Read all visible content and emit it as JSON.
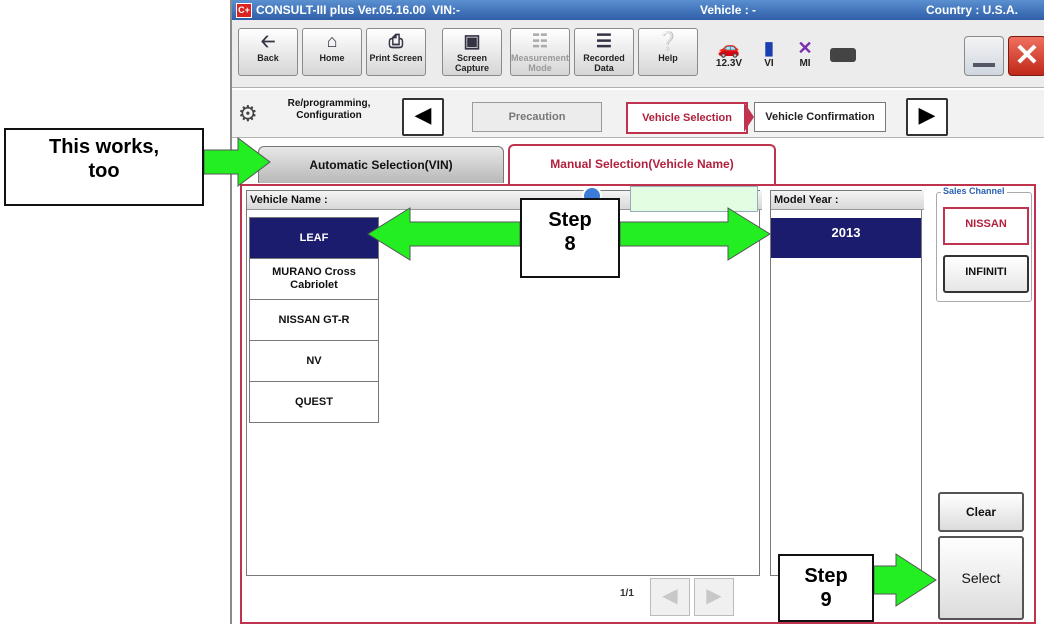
{
  "window": {
    "title": "CONSULT-III plus  Ver.05.16.00",
    "vin_label": "VIN:-",
    "vehicle_label": "Vehicle : -",
    "country_label": "Country : U.S.A."
  },
  "toolbar": {
    "buttons": [
      {
        "label": "Back",
        "icon": "back-arrow-icon"
      },
      {
        "label": "Home",
        "icon": "home-icon"
      },
      {
        "label": "Print Screen",
        "icon": "printer-icon"
      },
      {
        "label": "Screen Capture",
        "icon": "camera-icon"
      },
      {
        "label": "Measurement Mode",
        "icon": "measurement-icon"
      },
      {
        "label": "Recorded Data",
        "icon": "recorded-data-icon"
      },
      {
        "label": "Help",
        "icon": "help-icon"
      }
    ],
    "status": {
      "battery": "12.3V",
      "vi": "VI",
      "mi": "MI"
    }
  },
  "navigation": {
    "section_label": "Re/programming, Configuration",
    "steps": [
      "Precaution",
      "Vehicle Selection",
      "Vehicle Confirmation"
    ]
  },
  "tabs": {
    "automatic": "Automatic Selection(VIN)",
    "manual": "Manual Selection(Vehicle Name)"
  },
  "vehicle_list": {
    "header": "Vehicle Name :",
    "items": [
      "LEAF",
      "MURANO Cross Cabriolet",
      "NISSAN GT-R",
      "NV",
      "QUEST"
    ],
    "selected_index": 0,
    "page": "1/1"
  },
  "model_year": {
    "header": "Model Year :",
    "items": [
      "2013"
    ]
  },
  "sales_channel": {
    "label": "Sales Channel",
    "options": [
      "NISSAN",
      "INFINITI"
    ]
  },
  "actions": {
    "clear": "Clear",
    "select": "Select"
  },
  "callouts": {
    "auto_line1": "This works,",
    "auto_line2": "too",
    "step8_line1": "Step",
    "step8_line2": "8",
    "step9_line1": "Step",
    "step9_line2": "9"
  },
  "colors": {
    "selection_navy": "#1c1c6e",
    "accent_red": "#c0334e",
    "arrow_green": "#22ee22"
  }
}
